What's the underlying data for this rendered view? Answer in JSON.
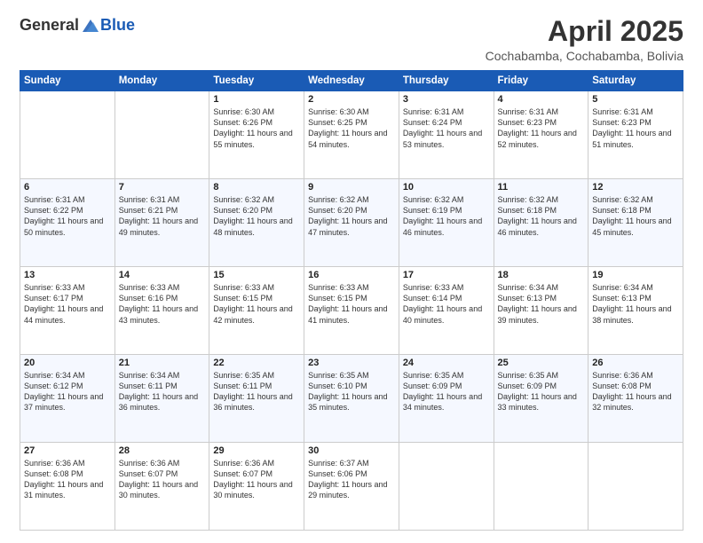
{
  "header": {
    "logo_general": "General",
    "logo_blue": "Blue",
    "month": "April 2025",
    "location": "Cochabamba, Cochabamba, Bolivia"
  },
  "days_of_week": [
    "Sunday",
    "Monday",
    "Tuesday",
    "Wednesday",
    "Thursday",
    "Friday",
    "Saturday"
  ],
  "weeks": [
    [
      {
        "day": "",
        "info": ""
      },
      {
        "day": "",
        "info": ""
      },
      {
        "day": "1",
        "info": "Sunrise: 6:30 AM\nSunset: 6:26 PM\nDaylight: 11 hours and 55 minutes."
      },
      {
        "day": "2",
        "info": "Sunrise: 6:30 AM\nSunset: 6:25 PM\nDaylight: 11 hours and 54 minutes."
      },
      {
        "day": "3",
        "info": "Sunrise: 6:31 AM\nSunset: 6:24 PM\nDaylight: 11 hours and 53 minutes."
      },
      {
        "day": "4",
        "info": "Sunrise: 6:31 AM\nSunset: 6:23 PM\nDaylight: 11 hours and 52 minutes."
      },
      {
        "day": "5",
        "info": "Sunrise: 6:31 AM\nSunset: 6:23 PM\nDaylight: 11 hours and 51 minutes."
      }
    ],
    [
      {
        "day": "6",
        "info": "Sunrise: 6:31 AM\nSunset: 6:22 PM\nDaylight: 11 hours and 50 minutes."
      },
      {
        "day": "7",
        "info": "Sunrise: 6:31 AM\nSunset: 6:21 PM\nDaylight: 11 hours and 49 minutes."
      },
      {
        "day": "8",
        "info": "Sunrise: 6:32 AM\nSunset: 6:20 PM\nDaylight: 11 hours and 48 minutes."
      },
      {
        "day": "9",
        "info": "Sunrise: 6:32 AM\nSunset: 6:20 PM\nDaylight: 11 hours and 47 minutes."
      },
      {
        "day": "10",
        "info": "Sunrise: 6:32 AM\nSunset: 6:19 PM\nDaylight: 11 hours and 46 minutes."
      },
      {
        "day": "11",
        "info": "Sunrise: 6:32 AM\nSunset: 6:18 PM\nDaylight: 11 hours and 46 minutes."
      },
      {
        "day": "12",
        "info": "Sunrise: 6:32 AM\nSunset: 6:18 PM\nDaylight: 11 hours and 45 minutes."
      }
    ],
    [
      {
        "day": "13",
        "info": "Sunrise: 6:33 AM\nSunset: 6:17 PM\nDaylight: 11 hours and 44 minutes."
      },
      {
        "day": "14",
        "info": "Sunrise: 6:33 AM\nSunset: 6:16 PM\nDaylight: 11 hours and 43 minutes."
      },
      {
        "day": "15",
        "info": "Sunrise: 6:33 AM\nSunset: 6:15 PM\nDaylight: 11 hours and 42 minutes."
      },
      {
        "day": "16",
        "info": "Sunrise: 6:33 AM\nSunset: 6:15 PM\nDaylight: 11 hours and 41 minutes."
      },
      {
        "day": "17",
        "info": "Sunrise: 6:33 AM\nSunset: 6:14 PM\nDaylight: 11 hours and 40 minutes."
      },
      {
        "day": "18",
        "info": "Sunrise: 6:34 AM\nSunset: 6:13 PM\nDaylight: 11 hours and 39 minutes."
      },
      {
        "day": "19",
        "info": "Sunrise: 6:34 AM\nSunset: 6:13 PM\nDaylight: 11 hours and 38 minutes."
      }
    ],
    [
      {
        "day": "20",
        "info": "Sunrise: 6:34 AM\nSunset: 6:12 PM\nDaylight: 11 hours and 37 minutes."
      },
      {
        "day": "21",
        "info": "Sunrise: 6:34 AM\nSunset: 6:11 PM\nDaylight: 11 hours and 36 minutes."
      },
      {
        "day": "22",
        "info": "Sunrise: 6:35 AM\nSunset: 6:11 PM\nDaylight: 11 hours and 36 minutes."
      },
      {
        "day": "23",
        "info": "Sunrise: 6:35 AM\nSunset: 6:10 PM\nDaylight: 11 hours and 35 minutes."
      },
      {
        "day": "24",
        "info": "Sunrise: 6:35 AM\nSunset: 6:09 PM\nDaylight: 11 hours and 34 minutes."
      },
      {
        "day": "25",
        "info": "Sunrise: 6:35 AM\nSunset: 6:09 PM\nDaylight: 11 hours and 33 minutes."
      },
      {
        "day": "26",
        "info": "Sunrise: 6:36 AM\nSunset: 6:08 PM\nDaylight: 11 hours and 32 minutes."
      }
    ],
    [
      {
        "day": "27",
        "info": "Sunrise: 6:36 AM\nSunset: 6:08 PM\nDaylight: 11 hours and 31 minutes."
      },
      {
        "day": "28",
        "info": "Sunrise: 6:36 AM\nSunset: 6:07 PM\nDaylight: 11 hours and 30 minutes."
      },
      {
        "day": "29",
        "info": "Sunrise: 6:36 AM\nSunset: 6:07 PM\nDaylight: 11 hours and 30 minutes."
      },
      {
        "day": "30",
        "info": "Sunrise: 6:37 AM\nSunset: 6:06 PM\nDaylight: 11 hours and 29 minutes."
      },
      {
        "day": "",
        "info": ""
      },
      {
        "day": "",
        "info": ""
      },
      {
        "day": "",
        "info": ""
      }
    ]
  ]
}
